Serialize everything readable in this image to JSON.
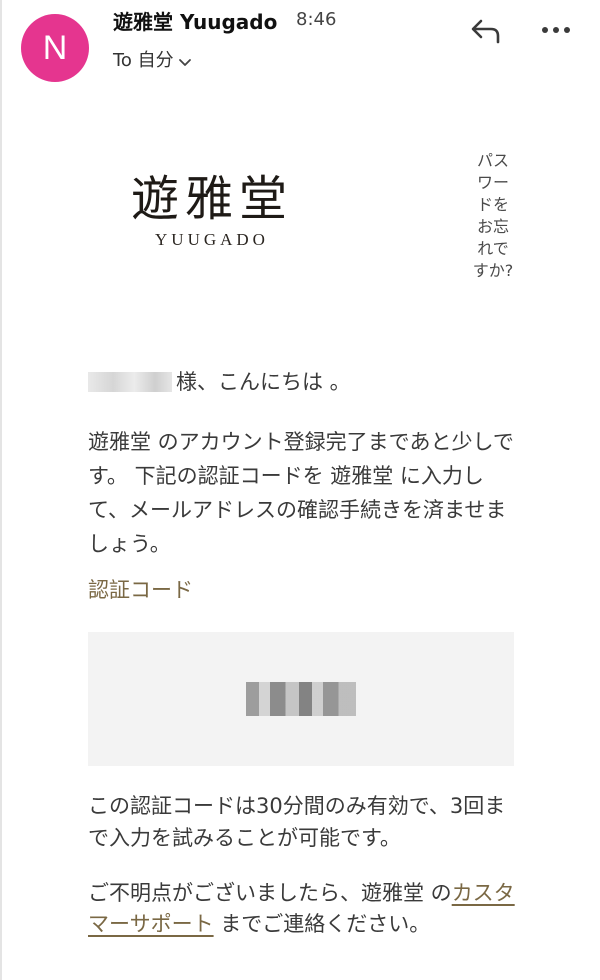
{
  "header": {
    "avatar_letter": "N",
    "avatar_color": "#e5358f",
    "sender": "遊雅堂 Yuugado",
    "time": "8:46",
    "recipient_line": "To 自分",
    "icons": [
      "reply-icon",
      "more-icon",
      "chevron-down-icon"
    ]
  },
  "email": {
    "brand_kanji": "遊雅堂",
    "brand_roman": "YUUGADO",
    "forgot_lines": [
      "パス",
      "ワー",
      "ドを",
      "お忘",
      "れで",
      "すか?"
    ],
    "greeting_suffix": "様、こんにちは 。",
    "body": "遊雅堂 のアカウント登録完了まであと少しです。 下記の認証コードを 遊雅堂 に入力して、メールアドレスの確認手続きを済ませましょう。",
    "code_label": "認証コード",
    "validity": "この認証コードは30分間のみ有効で、3回まで入力を試みることが可能です。",
    "contact_before": "ご不明点がございましたら、遊雅堂 の",
    "support_link": "カスタマーサポート",
    "contact_after": " までご連絡ください。",
    "accent_color": "#7a6844"
  }
}
